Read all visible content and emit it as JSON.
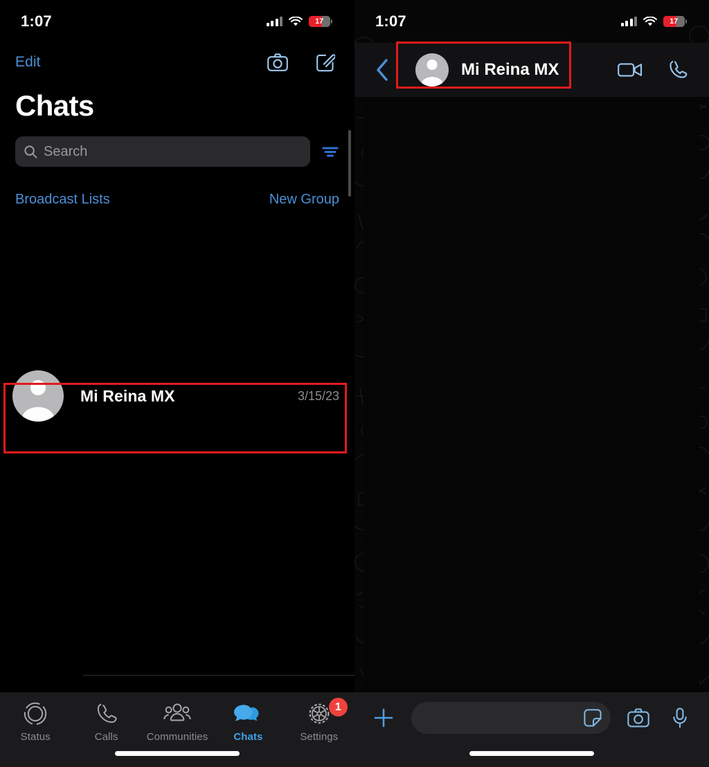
{
  "left": {
    "status_bar": {
      "time": "1:07",
      "battery_level": "17",
      "signal_icon": "cellular-signal-icon",
      "wifi_icon": "wifi-icon",
      "battery_icon": "battery-icon"
    },
    "nav": {
      "edit_label": "Edit",
      "camera_icon": "camera-icon",
      "compose_icon": "compose-icon"
    },
    "page_title": "Chats",
    "search": {
      "placeholder": "Search",
      "search_icon": "search-icon",
      "filter_icon": "filter-icon"
    },
    "links": {
      "broadcast_lists": "Broadcast Lists",
      "new_group": "New Group"
    },
    "chats": [
      {
        "name": "Mi Reina MX",
        "date": "3/15/23",
        "avatar": "person-avatar",
        "highlighted": true
      }
    ],
    "tabs": [
      {
        "label": "Status",
        "icon": "status-rings-icon",
        "active": false,
        "badge": ""
      },
      {
        "label": "Calls",
        "icon": "phone-icon",
        "active": false,
        "badge": ""
      },
      {
        "label": "Communities",
        "icon": "communities-icon",
        "active": false,
        "badge": ""
      },
      {
        "label": "Chats",
        "icon": "chat-bubbles-icon",
        "active": true,
        "badge": ""
      },
      {
        "label": "Settings",
        "icon": "gear-icon",
        "active": false,
        "badge": "1"
      }
    ]
  },
  "right": {
    "status_bar": {
      "time": "1:07",
      "battery_level": "17"
    },
    "nav": {
      "back_icon": "chevron-left-icon",
      "peer_name": "Mi Reina MX",
      "peer_avatar": "person-avatar",
      "video_call_icon": "video-camera-icon",
      "voice_call_icon": "phone-icon"
    },
    "conversation": {
      "messages": []
    },
    "input_bar": {
      "attach_icon": "plus-icon",
      "message_value": "",
      "message_placeholder": "",
      "sticker_icon": "sticker-icon",
      "camera_icon": "camera-icon",
      "mic_icon": "microphone-icon"
    }
  },
  "annotations": {
    "highlight_color": "#e21b1b",
    "boxes": [
      {
        "target": "chat-list-row-mi-reina-mx"
      },
      {
        "target": "conversation-header-peer"
      }
    ]
  },
  "theme": {
    "accent_blue": "#3fa1e8",
    "link_blue": "#4c8fd6",
    "tabbar_bg": "#1b1b1d",
    "field_bg": "#2a2a2c",
    "badge_red": "#f0423c",
    "battery_red": "#e8202a"
  }
}
